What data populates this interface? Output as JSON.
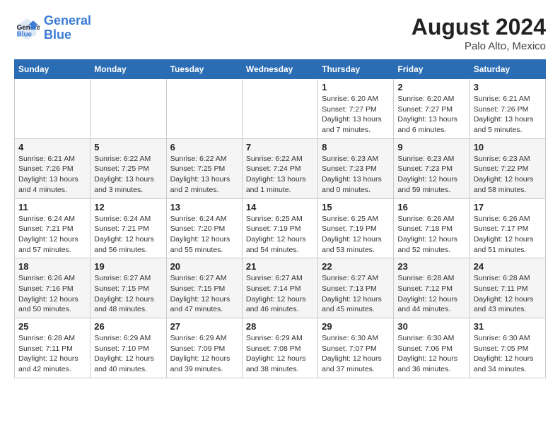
{
  "header": {
    "logo_line1": "General",
    "logo_line2": "Blue",
    "month_year": "August 2024",
    "location": "Palo Alto, Mexico"
  },
  "weekdays": [
    "Sunday",
    "Monday",
    "Tuesday",
    "Wednesday",
    "Thursday",
    "Friday",
    "Saturday"
  ],
  "weeks": [
    [
      {
        "day": "",
        "info": ""
      },
      {
        "day": "",
        "info": ""
      },
      {
        "day": "",
        "info": ""
      },
      {
        "day": "",
        "info": ""
      },
      {
        "day": "1",
        "info": "Sunrise: 6:20 AM\nSunset: 7:27 PM\nDaylight: 13 hours\nand 7 minutes."
      },
      {
        "day": "2",
        "info": "Sunrise: 6:20 AM\nSunset: 7:27 PM\nDaylight: 13 hours\nand 6 minutes."
      },
      {
        "day": "3",
        "info": "Sunrise: 6:21 AM\nSunset: 7:26 PM\nDaylight: 13 hours\nand 5 minutes."
      }
    ],
    [
      {
        "day": "4",
        "info": "Sunrise: 6:21 AM\nSunset: 7:26 PM\nDaylight: 13 hours\nand 4 minutes."
      },
      {
        "day": "5",
        "info": "Sunrise: 6:22 AM\nSunset: 7:25 PM\nDaylight: 13 hours\nand 3 minutes."
      },
      {
        "day": "6",
        "info": "Sunrise: 6:22 AM\nSunset: 7:25 PM\nDaylight: 13 hours\nand 2 minutes."
      },
      {
        "day": "7",
        "info": "Sunrise: 6:22 AM\nSunset: 7:24 PM\nDaylight: 13 hours\nand 1 minute."
      },
      {
        "day": "8",
        "info": "Sunrise: 6:23 AM\nSunset: 7:23 PM\nDaylight: 13 hours\nand 0 minutes."
      },
      {
        "day": "9",
        "info": "Sunrise: 6:23 AM\nSunset: 7:23 PM\nDaylight: 12 hours\nand 59 minutes."
      },
      {
        "day": "10",
        "info": "Sunrise: 6:23 AM\nSunset: 7:22 PM\nDaylight: 12 hours\nand 58 minutes."
      }
    ],
    [
      {
        "day": "11",
        "info": "Sunrise: 6:24 AM\nSunset: 7:21 PM\nDaylight: 12 hours\nand 57 minutes."
      },
      {
        "day": "12",
        "info": "Sunrise: 6:24 AM\nSunset: 7:21 PM\nDaylight: 12 hours\nand 56 minutes."
      },
      {
        "day": "13",
        "info": "Sunrise: 6:24 AM\nSunset: 7:20 PM\nDaylight: 12 hours\nand 55 minutes."
      },
      {
        "day": "14",
        "info": "Sunrise: 6:25 AM\nSunset: 7:19 PM\nDaylight: 12 hours\nand 54 minutes."
      },
      {
        "day": "15",
        "info": "Sunrise: 6:25 AM\nSunset: 7:19 PM\nDaylight: 12 hours\nand 53 minutes."
      },
      {
        "day": "16",
        "info": "Sunrise: 6:26 AM\nSunset: 7:18 PM\nDaylight: 12 hours\nand 52 minutes."
      },
      {
        "day": "17",
        "info": "Sunrise: 6:26 AM\nSunset: 7:17 PM\nDaylight: 12 hours\nand 51 minutes."
      }
    ],
    [
      {
        "day": "18",
        "info": "Sunrise: 6:26 AM\nSunset: 7:16 PM\nDaylight: 12 hours\nand 50 minutes."
      },
      {
        "day": "19",
        "info": "Sunrise: 6:27 AM\nSunset: 7:15 PM\nDaylight: 12 hours\nand 48 minutes."
      },
      {
        "day": "20",
        "info": "Sunrise: 6:27 AM\nSunset: 7:15 PM\nDaylight: 12 hours\nand 47 minutes."
      },
      {
        "day": "21",
        "info": "Sunrise: 6:27 AM\nSunset: 7:14 PM\nDaylight: 12 hours\nand 46 minutes."
      },
      {
        "day": "22",
        "info": "Sunrise: 6:27 AM\nSunset: 7:13 PM\nDaylight: 12 hours\nand 45 minutes."
      },
      {
        "day": "23",
        "info": "Sunrise: 6:28 AM\nSunset: 7:12 PM\nDaylight: 12 hours\nand 44 minutes."
      },
      {
        "day": "24",
        "info": "Sunrise: 6:28 AM\nSunset: 7:11 PM\nDaylight: 12 hours\nand 43 minutes."
      }
    ],
    [
      {
        "day": "25",
        "info": "Sunrise: 6:28 AM\nSunset: 7:11 PM\nDaylight: 12 hours\nand 42 minutes."
      },
      {
        "day": "26",
        "info": "Sunrise: 6:29 AM\nSunset: 7:10 PM\nDaylight: 12 hours\nand 40 minutes."
      },
      {
        "day": "27",
        "info": "Sunrise: 6:29 AM\nSunset: 7:09 PM\nDaylight: 12 hours\nand 39 minutes."
      },
      {
        "day": "28",
        "info": "Sunrise: 6:29 AM\nSunset: 7:08 PM\nDaylight: 12 hours\nand 38 minutes."
      },
      {
        "day": "29",
        "info": "Sunrise: 6:30 AM\nSunset: 7:07 PM\nDaylight: 12 hours\nand 37 minutes."
      },
      {
        "day": "30",
        "info": "Sunrise: 6:30 AM\nSunset: 7:06 PM\nDaylight: 12 hours\nand 36 minutes."
      },
      {
        "day": "31",
        "info": "Sunrise: 6:30 AM\nSunset: 7:05 PM\nDaylight: 12 hours\nand 34 minutes."
      }
    ]
  ]
}
